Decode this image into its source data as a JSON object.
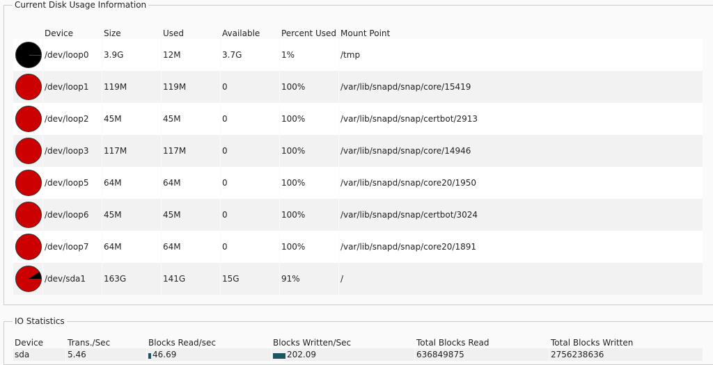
{
  "disk": {
    "title": "Current Disk Usage Information",
    "headers": [
      "Device",
      "Size",
      "Used",
      "Available",
      "Percent Used",
      "Mount Point"
    ],
    "rows": [
      {
        "device": "/dev/loop0",
        "size": "3.9G",
        "used": "12M",
        "available": "3.7G",
        "percent": "1%",
        "pct": 1,
        "mount": "/tmp"
      },
      {
        "device": "/dev/loop1",
        "size": "119M",
        "used": "119M",
        "available": "0",
        "percent": "100%",
        "pct": 100,
        "mount": "/var/lib/snapd/snap/core/15419"
      },
      {
        "device": "/dev/loop2",
        "size": "45M",
        "used": "45M",
        "available": "0",
        "percent": "100%",
        "pct": 100,
        "mount": "/var/lib/snapd/snap/certbot/2913"
      },
      {
        "device": "/dev/loop3",
        "size": "117M",
        "used": "117M",
        "available": "0",
        "percent": "100%",
        "pct": 100,
        "mount": "/var/lib/snapd/snap/core/14946"
      },
      {
        "device": "/dev/loop5",
        "size": "64M",
        "used": "64M",
        "available": "0",
        "percent": "100%",
        "pct": 100,
        "mount": "/var/lib/snapd/snap/core20/1950"
      },
      {
        "device": "/dev/loop6",
        "size": "45M",
        "used": "45M",
        "available": "0",
        "percent": "100%",
        "pct": 100,
        "mount": "/var/lib/snapd/snap/certbot/3024"
      },
      {
        "device": "/dev/loop7",
        "size": "64M",
        "used": "64M",
        "available": "0",
        "percent": "100%",
        "pct": 100,
        "mount": "/var/lib/snapd/snap/core20/1891"
      },
      {
        "device": "/dev/sda1",
        "size": "163G",
        "used": "141G",
        "available": "15G",
        "percent": "91%",
        "pct": 91,
        "mount": "/"
      }
    ]
  },
  "io": {
    "title": "IO Statistics",
    "headers": [
      "Device",
      "Trans./Sec",
      "Blocks Read/sec",
      "Blocks Written/Sec",
      "Total Blocks Read",
      "Total Blocks Written"
    ],
    "rows": [
      {
        "device": "sda",
        "trans": "5.46",
        "read": "46.69",
        "read_bar": 0.02,
        "written": "202.09",
        "written_bar": 0.1,
        "total_read": "636849875",
        "total_written": "2756238636"
      }
    ]
  },
  "colors": {
    "used": "#cc0000",
    "free": "#000000",
    "bar": "#1a5560"
  }
}
